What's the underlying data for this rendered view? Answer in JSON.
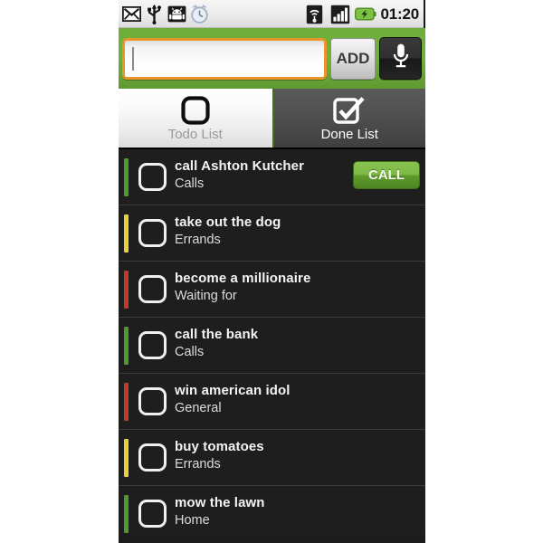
{
  "status_bar": {
    "icons_left": [
      {
        "name": "gmail-icon",
        "glyph": "M"
      },
      {
        "name": "usb-icon",
        "glyph": "usb"
      },
      {
        "name": "android-icon",
        "glyph": "android"
      },
      {
        "name": "alarm-clock-icon",
        "glyph": "alarm"
      }
    ],
    "icons_right": [
      {
        "name": "wifi-icon",
        "glyph": "wifi"
      },
      {
        "name": "signal-icon",
        "glyph": "signal"
      },
      {
        "name": "battery-charging-icon",
        "glyph": "battery"
      }
    ],
    "time": "01:20"
  },
  "entry_bar": {
    "input_value": "",
    "input_placeholder": "",
    "add_label": "ADD",
    "mic_name": "microphone-icon"
  },
  "tabs": [
    {
      "label": "Todo List",
      "icon": "unchecked-checkbox-icon",
      "active": true
    },
    {
      "label": "Done List",
      "icon": "checked-checkbox-icon",
      "active": false
    }
  ],
  "colors": {
    "accent_green": "#6fae3a",
    "input_border_orange": "#e8942a",
    "priority_high": "#c0392b",
    "priority_medium": "#e8d13a",
    "priority_low": "#4e9a2f",
    "call_button_green": "#7cb946",
    "list_background": "#1e1e1e"
  },
  "todo_items": [
    {
      "title": "call Ashton Kutcher",
      "category": "Calls",
      "priority_color": "#4e9a2f",
      "checked": false,
      "action_label": "CALL",
      "has_action": true
    },
    {
      "title": "take out the dog",
      "category": "Errands",
      "priority_color": "#e8d13a",
      "checked": false,
      "action_label": "",
      "has_action": false
    },
    {
      "title": "become a millionaire",
      "category": "Waiting for",
      "priority_color": "#c0392b",
      "checked": false,
      "action_label": "",
      "has_action": false
    },
    {
      "title": "call the bank",
      "category": "Calls",
      "priority_color": "#4e9a2f",
      "checked": false,
      "action_label": "",
      "has_action": false
    },
    {
      "title": "win american idol",
      "category": "General",
      "priority_color": "#c0392b",
      "checked": false,
      "action_label": "",
      "has_action": false
    },
    {
      "title": "buy tomatoes",
      "category": "Errands",
      "priority_color": "#e8d13a",
      "checked": false,
      "action_label": "",
      "has_action": false
    },
    {
      "title": "mow the lawn",
      "category": "Home",
      "priority_color": "#4e9a2f",
      "checked": false,
      "action_label": "",
      "has_action": false
    }
  ]
}
